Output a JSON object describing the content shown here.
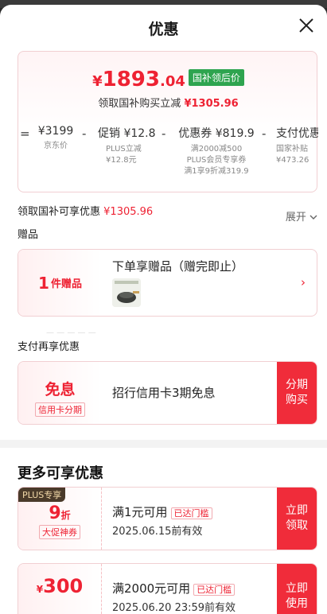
{
  "title": "优惠",
  "price": {
    "yen": "¥",
    "int": "1893",
    "dec": ".04",
    "tag": "国补领后价",
    "sub_prefix": "领取国补购买立减",
    "sub_amount": "¥1305.96"
  },
  "breakdown": [
    {
      "op": "=",
      "main": "¥3199",
      "subs": [
        "京东价"
      ]
    },
    {
      "op": "-",
      "main": "促销 ¥12.8",
      "subs": [
        "PLUS立减",
        "¥12.8元"
      ]
    },
    {
      "op": "-",
      "main": "优惠券 ¥819.9",
      "subs": [
        "满2000减500",
        "PLUS会员专享券",
        "满1享9折减319.9"
      ]
    },
    {
      "op": "-",
      "main": "支付优惠",
      "subs": [
        "国家补贴",
        "¥473.26"
      ]
    }
  ],
  "gov_subsidy": {
    "label": "领取国补可享优惠",
    "amount": "¥1305.96",
    "expand": "展开"
  },
  "gift": {
    "section": "赠品",
    "count": "1",
    "unit": "件赠品",
    "title": "下单享赠品（赠完即止）",
    "chevron": "›"
  },
  "pay": {
    "section": "支付再享优惠",
    "big": "免息",
    "small": "信用卡分期",
    "text": "招行信用卡3期免息",
    "button": [
      "分期",
      "购买"
    ]
  },
  "more": {
    "title": "更多可享优惠",
    "coupons": [
      {
        "tag": "PLUS专享",
        "value": "9",
        "unit": "折",
        "desc": "大促神券",
        "cond": "满1元可用",
        "badge": "已达门槛",
        "expiry": "2025.06.15前有效",
        "button": [
          "立即",
          "领取"
        ]
      },
      {
        "tag": "",
        "value": "300",
        "unit": "¥",
        "desc": "",
        "cond": "满2000元可用",
        "badge": "已达门槛",
        "expiry": "2025.06.20 23:59前有效",
        "button": [
          "立即",
          "使用"
        ]
      }
    ]
  },
  "colors": {
    "accent": "#ee2233",
    "tag_green": "#2ea44f",
    "button_red": "#f02c3a"
  }
}
